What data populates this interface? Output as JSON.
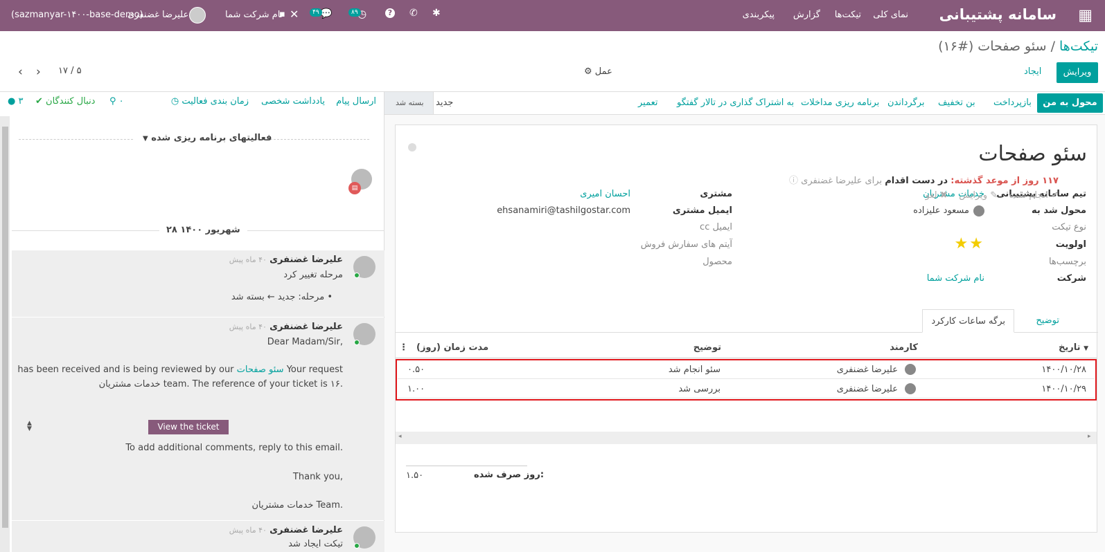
{
  "navbar": {
    "app_name": "سامانه پشتیبانی",
    "menu": [
      "نمای کلی",
      "تیکت‌ها",
      "گزارش",
      "پیکربندی"
    ],
    "db_name": "(sazmanyar-۱۴۰۰-base-demo)",
    "user_name": "علیرضا غضنفری",
    "company": "نام شرکت شما",
    "messages_count": "۴۹",
    "activities_count": "۸۹"
  },
  "breadcrumb": {
    "parent": "تیکت‌ها",
    "separator": "/",
    "current": "سئو صفحات (#۱۶)"
  },
  "actions": {
    "edit": "ویرایش",
    "create": "ایجاد",
    "action": "عمل",
    "pager": "۱۷ / ۵"
  },
  "statusbar": {
    "buttons": [
      "محول به من",
      "بازپرداخت",
      "بن تخفیف",
      "برگرداندن",
      "برنامه ریزی مداخلات",
      "به اشتراک گذاری در تالار گفتگو",
      "تعمیر"
    ],
    "stages": [
      "جدید",
      "بسته شد"
    ]
  },
  "form": {
    "title": "سئو صفحات",
    "fields_right": [
      {
        "label": "تیم سامانه پشتیبانی",
        "value": "خدمات مشتریان"
      },
      {
        "label": "محول شد به",
        "value": "مسعود علیزاده"
      },
      {
        "label": "نوع تیکت",
        "value": ""
      },
      {
        "label": "اولویت",
        "value": "★★"
      },
      {
        "label": "برچسب‌ها",
        "value": ""
      },
      {
        "label": "شرکت",
        "value": "نام شرکت شما"
      }
    ],
    "fields_left": [
      {
        "label": "مشتری",
        "value": "احسان امیری"
      },
      {
        "label": "ایمیل مشتری",
        "value": "ehsanamiri@tashilgostar.com"
      },
      {
        "label": "cc ایمیل",
        "value": ""
      },
      {
        "label": "آیتم های سفارش فروش",
        "value": ""
      },
      {
        "label": "محصول",
        "value": ""
      }
    ],
    "tabs": [
      "توضیح",
      "برگه ساعات کارکرد"
    ],
    "timesheet": {
      "headers": [
        "تاریخ",
        "کارمند",
        "توضیح",
        "مدت زمان (روز)"
      ],
      "rows": [
        {
          "date": "۱۴۰۰/۱۰/۲۸",
          "employee": "علیرضا غضنفری",
          "desc": "سئو انجام شد",
          "duration": "۰.۵۰"
        },
        {
          "date": "۱۴۰۰/۱۰/۲۹",
          "employee": "علیرضا غضنفری",
          "desc": "بررسی شد",
          "duration": "۱.۰۰"
        }
      ],
      "total_label": "روز صرف شده:",
      "total_value": "۱.۵۰"
    }
  },
  "chatter": {
    "send_message": "ارسال پیام",
    "log_note": "یادداشت شخصی",
    "schedule": "زمان بندی فعالیت",
    "attachments": "۰",
    "followers_label": "دنبال کنندگان",
    "followers_count": "۳",
    "planned_header": "فعالیتهای برنامه ریزی شده",
    "activity": {
      "overdue": "۱۱۷ روز از موعد گذشته:",
      "type": "در دست اقدام",
      "for": "برای علیرضا غضنفری",
      "done": "انجام شده",
      "edit": "ویرایش",
      "cancel": "لغو"
    },
    "date_sep": "۲۸ شهریور ۱۴۰۰",
    "messages": [
      {
        "author": "علیرضا غضنفری",
        "time": "۴۰ ماه پیش",
        "body": "مرحله تغییر کرد",
        "tracking": "مرحله: جدید ← بسته شد"
      },
      {
        "author": "علیرضا غضنفری",
        "time": "۴۰ ماه پیش",
        "l1": "Dear Madam/Sir,",
        "l2a": "Your request",
        "l2link": "سئو صفحات",
        "l2b": "has been received and is being reviewed by our",
        "l3": "خدمات مشتریان team. The reference of your ticket is ۱۶.",
        "button": "View the ticket",
        "l4": "To add additional comments, reply to this email.",
        "l5": "Thank you,",
        "l6": "خدمات مشتریان Team."
      },
      {
        "author": "علیرضا غضنفری",
        "time": "۴۰ ماه پیش",
        "body": "تیکت ایجاد شد"
      }
    ]
  }
}
